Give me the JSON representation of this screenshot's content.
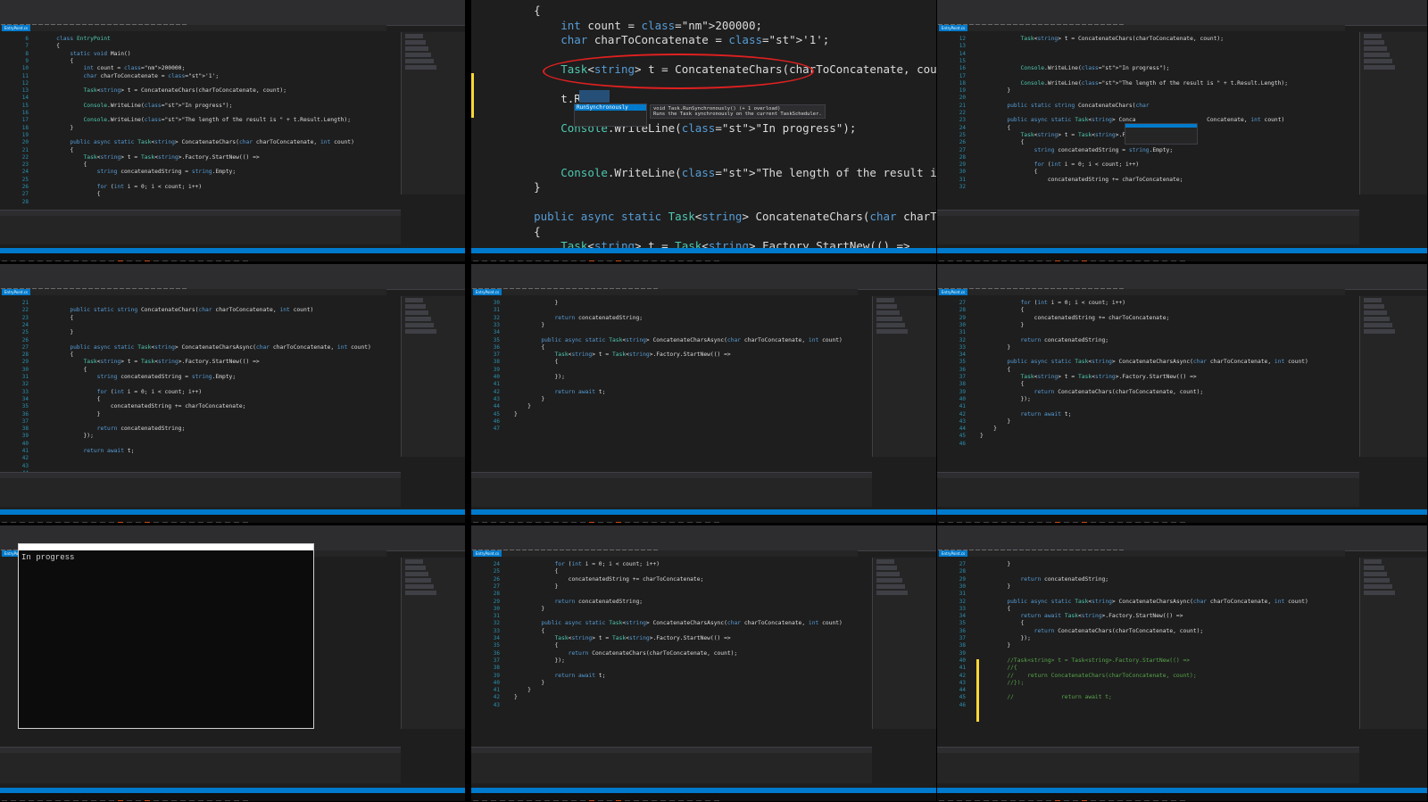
{
  "menu": [
    "File",
    "Edit",
    "View",
    "Project",
    "Build",
    "Debug",
    "Team",
    "Tools",
    "Test",
    "Analyze",
    "Window",
    "Help"
  ],
  "tab_label": "EntryPoint.cs",
  "pane1": {
    "lines": [
      "6",
      "7",
      "8",
      "9",
      "10",
      "11",
      "12",
      "13",
      "14",
      "15",
      "16",
      "17",
      "18",
      "19",
      "20",
      "21",
      "22",
      "23",
      "24",
      "25",
      "26",
      "27",
      "28"
    ],
    "code": [
      "    class EntryPoint",
      "    {",
      "        static void Main()",
      "        {",
      "            int count = 200000;",
      "            char charToConcatenate = '1';",
      "",
      "            Task<string> t = ConcatenateChars(charToConcatenate, count);",
      "",
      "            Console.WriteLine(\"In progress\");",
      "",
      "            Console.WriteLine(\"The length of the result is \" + t.Result.Length);",
      "        }",
      "",
      "        public async static Task<string> ConcatenateChars(char charToConcatenate, int count)",
      "        {",
      "            Task<string> t = Task<string>.Factory.StartNew(() =>",
      "            {",
      "                string concatenatedString = string.Empty;",
      "",
      "                for (int i = 0; i < count; i++)",
      "                {"
    ]
  },
  "pane2": {
    "code": [
      "    {",
      "        int count = 200000;",
      "        char charToConcatenate = '1';",
      "",
      "        Task<string> t = ConcatenateChars(charToConcatenate, count);",
      "",
      "        t.Run",
      "",
      "        Console.WriteLine(\"In progress\");",
      "",
      "",
      "        Console.WriteLine(\"The length of the result is \" + t.Result.L",
      "    }",
      "",
      "    public async static Task<string> ConcatenateChars(char charToConc",
      "    {",
      "        Task<string> t = Task<string>.Factory.StartNew(() =>",
      "        {"
    ],
    "completion_item": "RunSynchronously",
    "tooltip_line1": "void Task.RunSynchronously() (+ 1 overload)",
    "tooltip_line2": "Runs the Task synchronously on the current TaskScheduler."
  },
  "pane3": {
    "lines": [
      "12",
      "13",
      "14",
      "15",
      "16",
      "17",
      "18",
      "19",
      "20",
      "21",
      "22",
      "23",
      "24",
      "25",
      "26",
      "27",
      "28",
      "29",
      "30",
      "31",
      "32"
    ],
    "code": [
      "            Task<string> t = ConcatenateChars(charToConcatenate, count);",
      "",
      "",
      "",
      "            Console.WriteLine(\"In progress\");",
      "",
      "            Console.WriteLine(\"The length of the result is \" + t.Result.Length);",
      "        }",
      "",
      "        public static string ConcatenateChars(char",
      "",
      "        public async static Task<string> Conca                     Concatenate, int count)",
      "        {",
      "            Task<string> t = Task<string>.Factory.",
      "            {",
      "                string concatenatedString = string.Empty;",
      "",
      "                for (int i = 0; i < count; i++)",
      "                {",
      "                    concatenatedString += charToConcatenate;"
    ]
  },
  "pane4": {
    "lines": [
      "21",
      "22",
      "23",
      "24",
      "25",
      "26",
      "27",
      "28",
      "29",
      "30",
      "31",
      "32",
      "33",
      "34",
      "35",
      "36",
      "37",
      "38",
      "39",
      "40",
      "41",
      "42",
      "43",
      "44",
      "45",
      "46"
    ],
    "code": [
      "",
      "        public static string ConcatenateChars(char charToConcatenate, int count)",
      "        {",
      "",
      "        }",
      "",
      "        public async static Task<string> ConcatenateCharsAsync(char charToConcatenate, int count)",
      "        {",
      "            Task<string> t = Task<string>.Factory.StartNew(() =>",
      "            {",
      "                string concatenatedString = string.Empty;",
      "",
      "                for (int i = 0; i < count; i++)",
      "                {",
      "                    concatenatedString += charToConcatenate;",
      "                }",
      "",
      "                return concatenatedString;",
      "            });",
      "",
      "            return await t;"
    ]
  },
  "pane5": {
    "lines": [
      "30",
      "31",
      "32",
      "33",
      "34",
      "35",
      "36",
      "37",
      "38",
      "39",
      "40",
      "41",
      "42",
      "43",
      "44",
      "45",
      "46",
      "47"
    ],
    "code": [
      "            }",
      "",
      "            return concatenatedString;",
      "        }",
      "",
      "        public async static Task<string> ConcatenateCharsAsync(char charToConcatenate, int count)",
      "        {",
      "            Task<string> t = Task<string>.Factory.StartNew(() =>",
      "            {",
      "",
      "            });",
      "",
      "            return await t;",
      "        }",
      "    }",
      "}"
    ]
  },
  "pane6": {
    "lines": [
      "27",
      "28",
      "29",
      "30",
      "31",
      "32",
      "33",
      "34",
      "35",
      "36",
      "37",
      "38",
      "39",
      "40",
      "41",
      "42",
      "43",
      "44",
      "45",
      "46"
    ],
    "code": [
      "            for (int i = 0; i < count; i++)",
      "            {",
      "                concatenatedString += charToConcatenate;",
      "            }",
      "",
      "            return concatenatedString;",
      "        }",
      "",
      "        public async static Task<string> ConcatenateCharsAsync(char charToConcatenate, int count)",
      "        {",
      "            Task<string> t = Task<string>.Factory.StartNew(() =>",
      "            {",
      "                return ConcatenateChars(charToConcatenate, count);",
      "            });",
      "",
      "            return await t;",
      "        }",
      "    }",
      "}"
    ]
  },
  "pane7": {
    "console_text": "In progress"
  },
  "pane8": {
    "lines": [
      "24",
      "25",
      "26",
      "27",
      "28",
      "29",
      "30",
      "31",
      "32",
      "33",
      "34",
      "35",
      "36",
      "37",
      "38",
      "39",
      "40",
      "41",
      "42",
      "43"
    ],
    "code": [
      "            for (int i = 0; i < count; i++)",
      "            {",
      "                concatenatedString += charToConcatenate;",
      "            }",
      "",
      "            return concatenatedString;",
      "        }",
      "",
      "        public async static Task<string> ConcatenateCharsAsync(char charToConcatenate, int count)",
      "        {",
      "            Task<string> t = Task<string>.Factory.StartNew(() =>",
      "            {",
      "                return ConcatenateChars(charToConcatenate, count);",
      "            });",
      "",
      "            return await t;",
      "        }",
      "    }",
      "}"
    ]
  },
  "pane9": {
    "lines": [
      "27",
      "28",
      "29",
      "30",
      "31",
      "32",
      "33",
      "34",
      "35",
      "36",
      "37",
      "38",
      "39",
      "40",
      "41",
      "42",
      "43",
      "44",
      "45",
      "46"
    ],
    "code": [
      "        }",
      "",
      "            return concatenatedString;",
      "        }",
      "",
      "        public async static Task<string> ConcatenateCharsAsync(char charToConcatenate, int count)",
      "        {",
      "            return await Task<string>.Factory.StartNew(() =>",
      "            {",
      "                return ConcatenateChars(charToConcatenate, count);",
      "            });",
      "        }",
      "",
      "        //Task<string> t = Task<string>.Factory.StartNew(() =>",
      "        //{",
      "        //    return ConcatenateChars(charToConcatenate, count);",
      "        //});",
      "",
      "        //              return await t;"
    ]
  }
}
